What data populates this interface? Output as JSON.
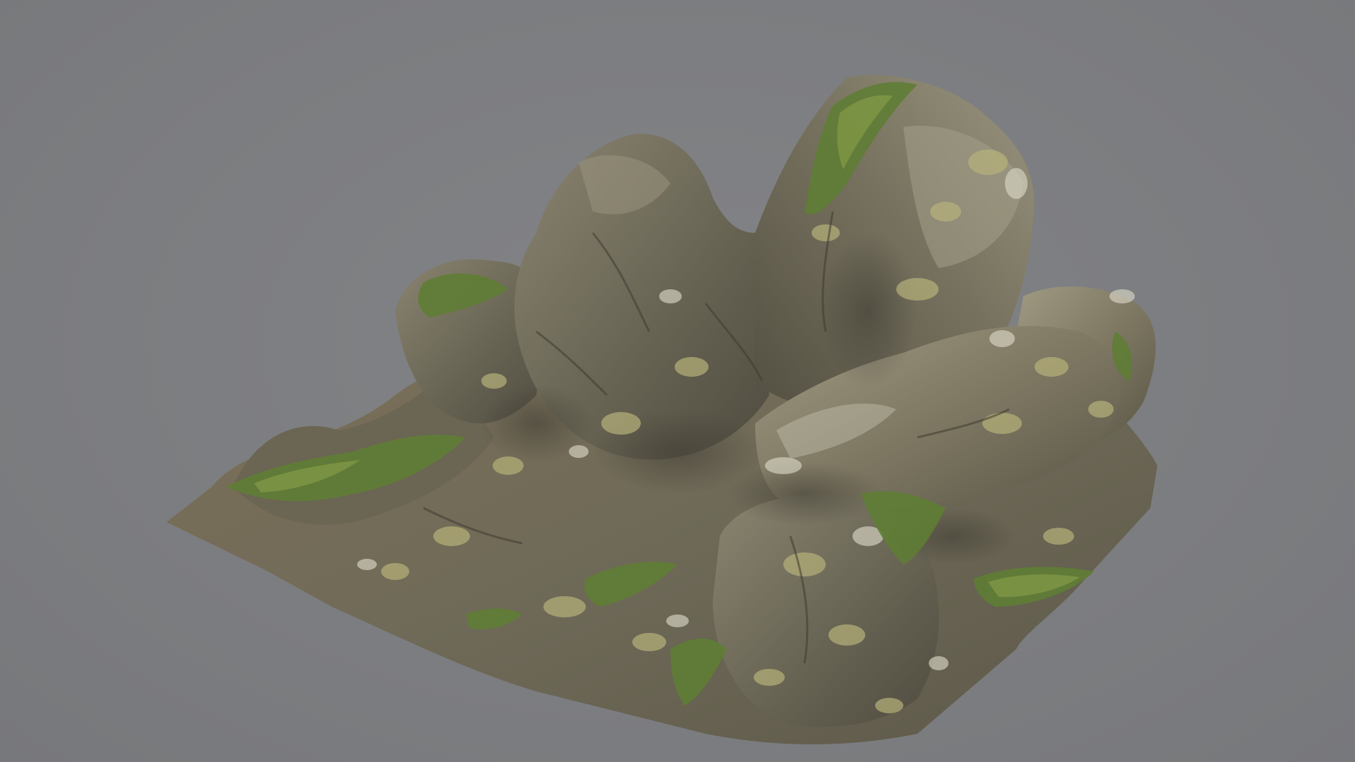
{
  "viewport": {
    "background_color": "#7d7e81"
  },
  "model": {
    "subject": "rock-formation",
    "colors": {
      "rock_dark": "#4e4b40",
      "rock_mid": "#6f6a58",
      "rock_light": "#8f8a76",
      "earth": "#7a6b4f",
      "lichen": "#b7b27a",
      "lichen_pale": "#d8d6c4",
      "grass": "#5f7d35",
      "grass_light": "#8aa04a"
    }
  }
}
